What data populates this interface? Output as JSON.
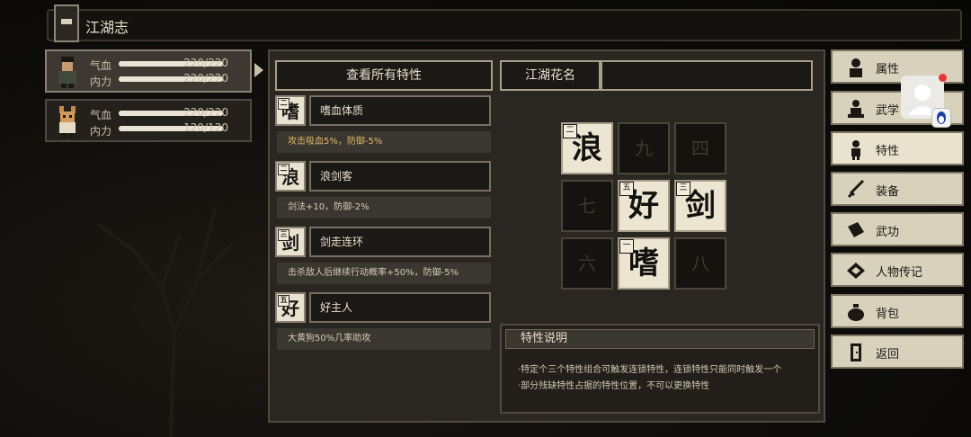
{
  "header": {
    "title": "江湖志"
  },
  "characters": [
    {
      "hp_label": "气血",
      "hp": "220/220",
      "hp_fill": 1.0,
      "mp_label": "内力",
      "mp": "220/220",
      "mp_fill": 1.0
    },
    {
      "hp_label": "气血",
      "hp": "220/220",
      "hp_fill": 1.0,
      "mp_label": "内力",
      "mp": "120/120",
      "mp_fill": 1.0
    }
  ],
  "panel": {
    "view_all": "查看所有特性",
    "nickname": "江湖花名"
  },
  "traits": [
    {
      "char": "嗜",
      "rank": "二",
      "name": "嗜血体质",
      "desc": "攻击吸血5%，防御-5%"
    },
    {
      "char": "浪",
      "rank": "二",
      "name": "浪剑客",
      "desc": "剑法+10，防御-2%"
    },
    {
      "char": "剑",
      "rank": "三",
      "name": "剑走连环",
      "desc": "击杀敌人后继续行动概率+50%，防御-5%"
    },
    {
      "char": "好",
      "rank": "五",
      "name": "好主人",
      "desc": "大黄狗50%几率助攻"
    }
  ],
  "grid": [
    {
      "text": "浪",
      "rank": "二",
      "on": true
    },
    {
      "text": "九",
      "rank": "",
      "on": false
    },
    {
      "text": "四",
      "rank": "",
      "on": false
    },
    {
      "text": "七",
      "rank": "",
      "on": false
    },
    {
      "text": "好",
      "rank": "五",
      "on": true
    },
    {
      "text": "剑",
      "rank": "三",
      "on": true
    },
    {
      "text": "六",
      "rank": "",
      "on": false
    },
    {
      "text": "嗜",
      "rank": "一",
      "on": true
    },
    {
      "text": "八",
      "rank": "",
      "on": false
    }
  ],
  "info": {
    "title": "特性说明",
    "lines": [
      "·特定个三个特性组合可触发连锁特性，连锁特性只能同时触发一个",
      "·部分残缺特性占据的特性位置，不可以更换特性"
    ]
  },
  "menu": [
    {
      "label": "属性",
      "icon": "person-icon"
    },
    {
      "label": "武学",
      "icon": "meditate-icon"
    },
    {
      "label": "特性",
      "icon": "figure-icon"
    },
    {
      "label": "装备",
      "icon": "sword-icon"
    },
    {
      "label": "武功",
      "icon": "book-icon"
    },
    {
      "label": "人物传记",
      "icon": "scroll-icon"
    },
    {
      "label": "背包",
      "icon": "bag-icon"
    },
    {
      "label": "返回",
      "icon": "door-icon"
    }
  ]
}
